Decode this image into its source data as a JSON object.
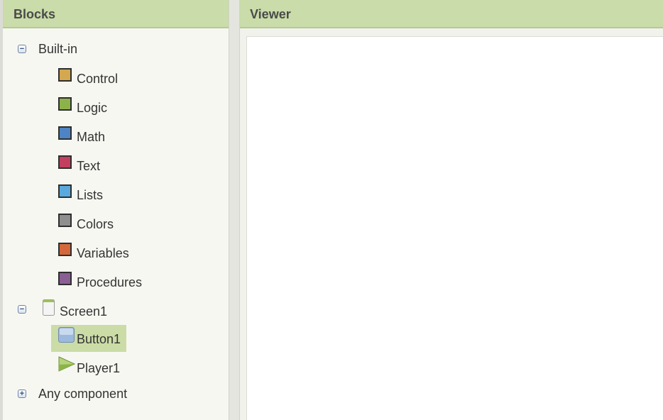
{
  "blocks_panel": {
    "title": "Blocks",
    "builtin": {
      "label": "Built-in",
      "toggle": "−",
      "items": [
        {
          "label": "Control",
          "color": "#d4a84f"
        },
        {
          "label": "Logic",
          "color": "#8cb34a"
        },
        {
          "label": "Math",
          "color": "#4f84c4"
        },
        {
          "label": "Text",
          "color": "#c2405e"
        },
        {
          "label": "Lists",
          "color": "#5aa9de"
        },
        {
          "label": "Colors",
          "color": "#8f8f8f"
        },
        {
          "label": "Variables",
          "color": "#d4683a"
        },
        {
          "label": "Procedures",
          "color": "#8a5f94"
        }
      ]
    },
    "screen": {
      "label": "Screen1",
      "toggle": "−",
      "items": [
        {
          "label": "Button1",
          "icon": "button-icon",
          "selected": true
        },
        {
          "label": "Player1",
          "icon": "player-icon",
          "selected": false
        }
      ]
    },
    "any_component": {
      "label": "Any component",
      "toggle": "+"
    }
  },
  "viewer_panel": {
    "title": "Viewer"
  },
  "colors": {
    "header_bg": "#c9dca9",
    "selection_bg": "#cbdca6"
  }
}
